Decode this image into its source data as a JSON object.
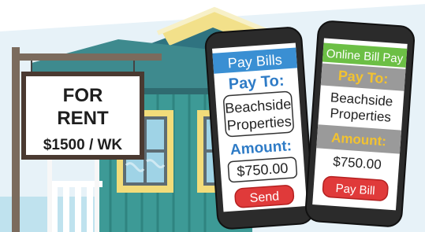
{
  "sign": {
    "line1": "FOR",
    "line2": "RENT",
    "price": "$1500 / WK"
  },
  "phone_left": {
    "title": "Pay Bills",
    "pay_to_label": "Pay To:",
    "payee_line1": "Beachside",
    "payee_line2": "Properties",
    "amount_label": "Amount:",
    "amount_value": "$750.00",
    "action_label": "Send"
  },
  "phone_right": {
    "title": "Online Bill Pay",
    "pay_to_label": "Pay To:",
    "payee_line1": "Beachside",
    "payee_line2": "Properties",
    "amount_label": "Amount:",
    "amount_value": "$750.00",
    "action_label": "Pay Bill"
  },
  "colors": {
    "sky": "#e6f1f7",
    "house_wall": "#3d9a96",
    "roof": "#3b7f84",
    "left_accent": "#2e7bc6",
    "left_title_bg": "#3a8fd3",
    "right_title_bg": "#6cbf45",
    "right_accent": "#f2c230",
    "button_red": "#e03a3a",
    "phone_body": "#2b2b2b"
  }
}
